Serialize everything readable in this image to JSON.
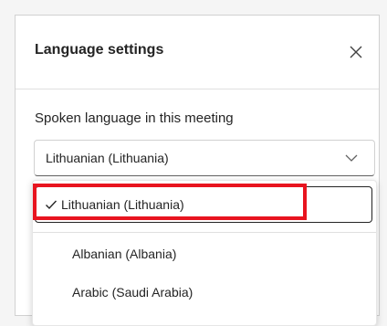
{
  "dialog": {
    "title": "Language settings",
    "close_icon": "close-icon"
  },
  "spoken_language": {
    "label": "Spoken language in this meeting",
    "selected_value": "Lithuanian (Lithuania)",
    "chevron_icon": "chevron-down-icon"
  },
  "dropdown": {
    "selected_option": "Lithuanian (Lithuania)",
    "check_icon": "checkmark-icon",
    "options": [
      "Albanian (Albania)",
      "Arabic (Saudi Arabia)"
    ]
  },
  "colors": {
    "highlight": "#e8141f",
    "panel_bg": "#ffffff",
    "page_bg": "#f5f5f5"
  }
}
